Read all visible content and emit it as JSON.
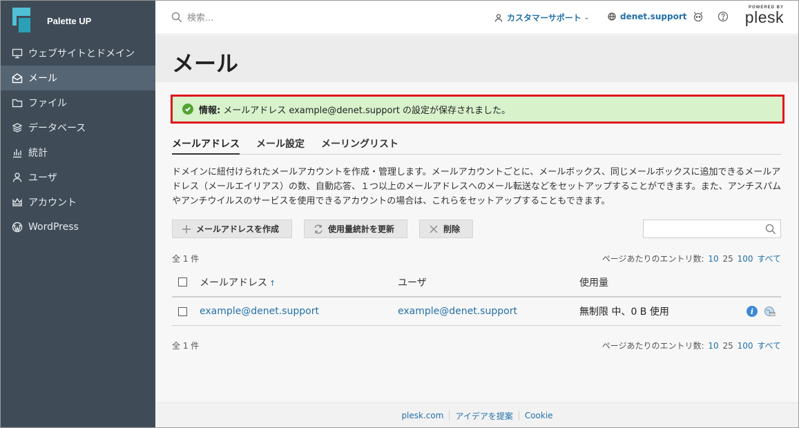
{
  "brand": {
    "name": "Palette UP"
  },
  "sidebar": {
    "items": [
      {
        "label": "ウェブサイトとドメイン",
        "icon": "monitor-icon"
      },
      {
        "label": "メール",
        "icon": "mail-icon",
        "active": true
      },
      {
        "label": "ファイル",
        "icon": "folder-icon"
      },
      {
        "label": "データベース",
        "icon": "database-icon"
      },
      {
        "label": "統計",
        "icon": "bar-chart-icon"
      },
      {
        "label": "ユーザ",
        "icon": "user-icon"
      },
      {
        "label": "アカウント",
        "icon": "crown-icon"
      },
      {
        "label": "WordPress",
        "icon": "wordpress-icon"
      }
    ],
    "collapse_glyph": "‹"
  },
  "header": {
    "search_placeholder": "検索...",
    "support_label": "カスタマーサポート",
    "domain_label": "denet.support",
    "plesk_powered": "POWERED BY",
    "plesk_word": "plesk"
  },
  "page": {
    "title": "メール",
    "alert": {
      "label": "情報:",
      "message": "メールアドレス example@denet.support の設定が保存されました。"
    },
    "tabs": [
      "メールアドレス",
      "メール設定",
      "メーリングリスト"
    ],
    "description": "ドメインに紐付けられたメールアカウントを作成・管理します。メールアカウントごとに、メールボックス、同じメールボックスに追加できるメールアドレス（メールエイリアス）の数、自動応答、１つ以上のメールアドレスへのメール転送などをセットアップすることができます。また、アンチスパムやアンチウイルスのサービスを使用できるアカウントの場合は、これらをセットアップすることもできます。",
    "toolbar": {
      "create": "メールアドレスを作成",
      "refresh": "使用量統計を更新",
      "delete": "削除"
    },
    "total": "全 1 件",
    "per_page_label": "ページあたりのエントリ数:",
    "per_page_options": [
      "10",
      "25",
      "100",
      "すべて"
    ],
    "per_page_current": "25"
  },
  "table": {
    "headers": {
      "address": "メールアドレス",
      "user": "ユーザ",
      "usage": "使用量"
    },
    "sort_glyph": "↑",
    "rows": [
      {
        "address": "example@denet.support",
        "user": "example@denet.support",
        "usage": "無制限 中、0 B 使用"
      }
    ]
  },
  "footer": {
    "links": [
      "plesk.com",
      "アイデアを提案",
      "Cookie"
    ]
  }
}
